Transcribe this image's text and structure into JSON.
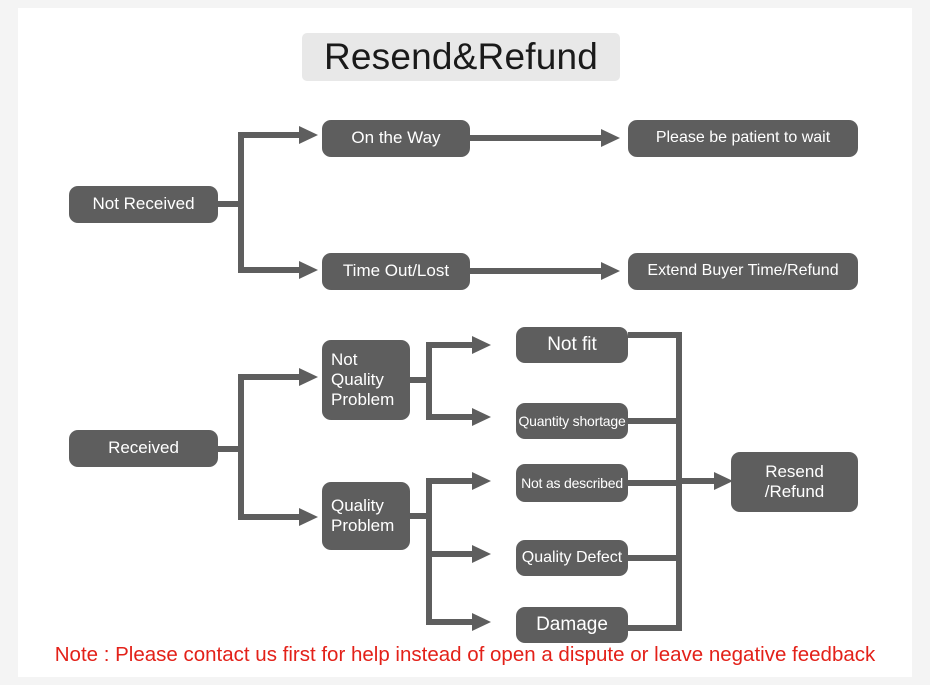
{
  "title": "Resend&Refund",
  "colors": {
    "node_fill": "#5e5e5e",
    "node_text": "#ffffff",
    "title_highlight": "#e8e8e8",
    "note_text": "#e32119",
    "page_background": "#f4f4f4",
    "sheet_background": "#ffffff"
  },
  "nodes": {
    "not_received": "Not Received",
    "on_the_way": "On the Way",
    "time_out_lost": "Time Out/Lost",
    "please_be_patient": "Please be patient to wait",
    "extend_buyer_time": "Extend Buyer Time/Refund",
    "received": "Received",
    "not_quality_problem": "Not\nQuality\nProblem",
    "quality_problem": "Quality\nProblem",
    "not_fit": "Not fit",
    "quantity_shortage": "Quantity shortage",
    "not_as_described": "Not as described",
    "quality_defect": "Quality Defect",
    "damage": "Damage",
    "resend_refund": "Resend\n/Refund"
  },
  "note": "Note : Please contact us first for help instead of open a dispute or leave negative feedback",
  "flow": {
    "branches": [
      {
        "from": "Not Received",
        "to": [
          "On the Way",
          "Time Out/Lost"
        ]
      },
      {
        "from": "On the Way",
        "to": [
          "Please be patient to wait"
        ]
      },
      {
        "from": "Time Out/Lost",
        "to": [
          "Extend Buyer Time/Refund"
        ]
      },
      {
        "from": "Received",
        "to": [
          "Not Quality Problem",
          "Quality Problem"
        ]
      },
      {
        "from": "Not Quality Problem",
        "to": [
          "Not fit",
          "Quantity shortage"
        ]
      },
      {
        "from": "Quality Problem",
        "to": [
          "Not as described",
          "Quality Defect",
          "Damage"
        ]
      },
      {
        "from": [
          "Not fit",
          "Quantity shortage",
          "Not as described",
          "Quality Defect",
          "Damage"
        ],
        "to": [
          "Resend /Refund"
        ]
      }
    ]
  }
}
